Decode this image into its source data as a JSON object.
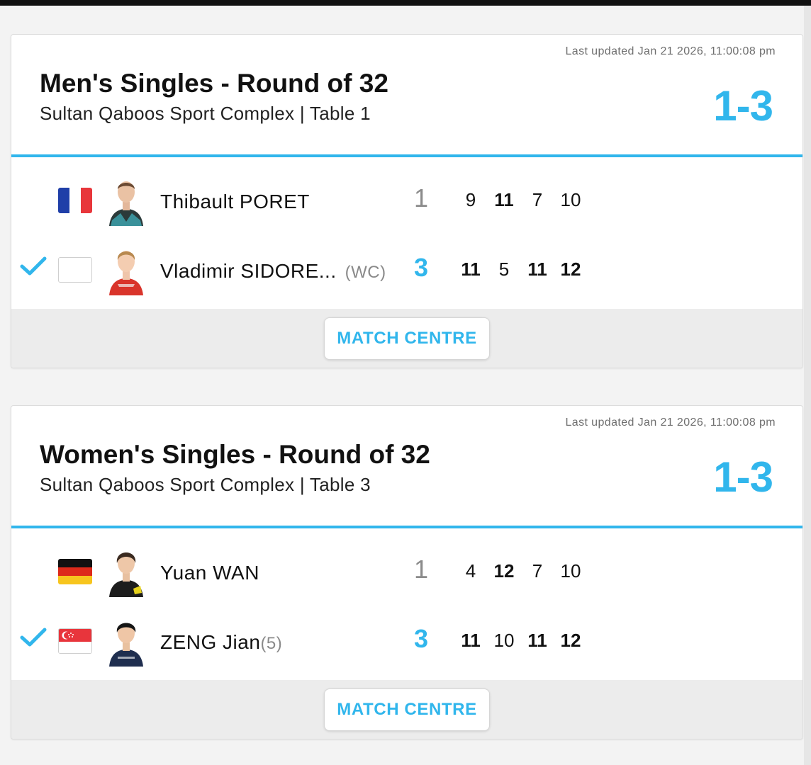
{
  "accent_color": "#31b6ec",
  "matches": [
    {
      "updated": "Last updated Jan 21 2026, 11:00:08 pm",
      "title": "Men's Singles - Round of 32",
      "venue": "Sultan Qaboos Sport Complex | Table 1",
      "score": "1-3",
      "players": [
        {
          "name": "Thibault PORET",
          "seed": "",
          "flag": "france-flag",
          "games_won": "1",
          "winner": false,
          "sets": [
            "9",
            "11",
            "7",
            "10"
          ]
        },
        {
          "name": "Vladimir SIDORE...",
          "seed": "(WC)",
          "flag": "blank-flag",
          "games_won": "3",
          "winner": true,
          "sets": [
            "11",
            "5",
            "11",
            "12"
          ]
        }
      ],
      "button": "MATCH CENTRE"
    },
    {
      "updated": "Last updated Jan 21 2026, 11:00:08 pm",
      "title": "Women's Singles - Round of 32",
      "venue": "Sultan Qaboos Sport Complex | Table 3",
      "score": "1-3",
      "players": [
        {
          "name": "Yuan WAN",
          "seed": "",
          "flag": "germany-flag",
          "games_won": "1",
          "winner": false,
          "sets": [
            "4",
            "12",
            "7",
            "10"
          ]
        },
        {
          "name": "ZENG Jian",
          "seed": "(5)",
          "flag": "singapore-flag",
          "games_won": "3",
          "winner": true,
          "sets": [
            "11",
            "10",
            "11",
            "12"
          ]
        }
      ],
      "button": "MATCH CENTRE"
    }
  ]
}
